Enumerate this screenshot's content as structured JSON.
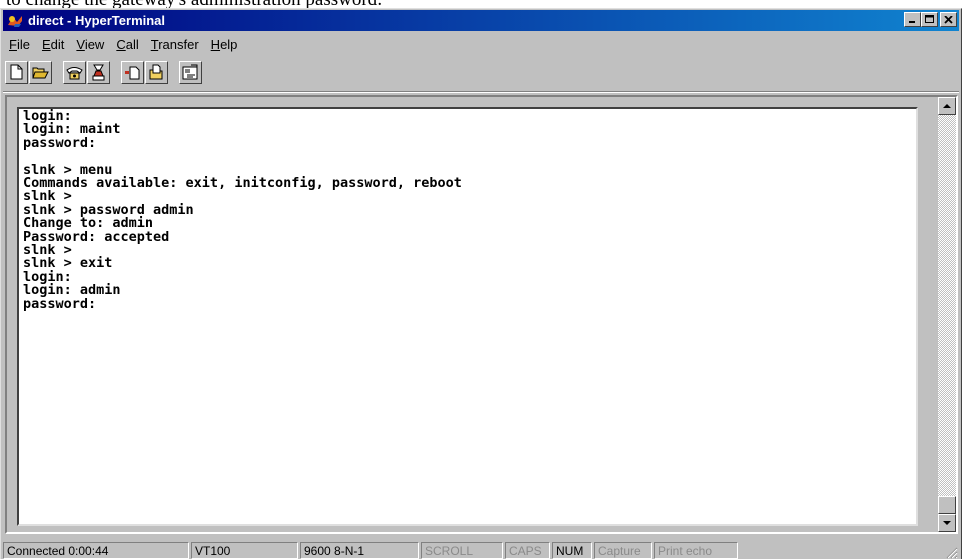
{
  "caption": "to change the gateway's administration password:",
  "window": {
    "title": "direct - HyperTerminal"
  },
  "menu": [
    {
      "label": "File",
      "key": "F",
      "rest": "ile"
    },
    {
      "label": "Edit",
      "key": "E",
      "rest": "dit"
    },
    {
      "label": "View",
      "key": "V",
      "rest": "iew"
    },
    {
      "label": "Call",
      "key": "C",
      "rest": "all"
    },
    {
      "label": "Transfer",
      "key": "T",
      "rest": "ransfer"
    },
    {
      "label": "Help",
      "key": "H",
      "rest": "elp"
    }
  ],
  "toolbar": [
    "new-icon",
    "open-icon",
    "connect-icon",
    "disconnect-icon",
    "send-icon",
    "receive-icon",
    "properties-icon"
  ],
  "terminal": {
    "lines": [
      "login:",
      "login: maint",
      "password:",
      "",
      "slnk > menu",
      "Commands available: exit, initconfig, password, reboot",
      "slnk >",
      "slnk > password admin",
      "Change to: admin",
      "Password: accepted",
      "slnk >",
      "slnk > exit",
      "login:",
      "login: admin",
      "password:"
    ]
  },
  "status": {
    "connected": "Connected 0:00:44",
    "emulation": "VT100",
    "port_settings": "9600 8-N-1",
    "scroll": "SCROLL",
    "caps": "CAPS",
    "num": "NUM",
    "capture": "Capture",
    "print_echo": "Print echo"
  },
  "colors": {
    "titlebar_start": "#000080",
    "titlebar_end": "#1084d0",
    "face": "#c0c0c0"
  }
}
